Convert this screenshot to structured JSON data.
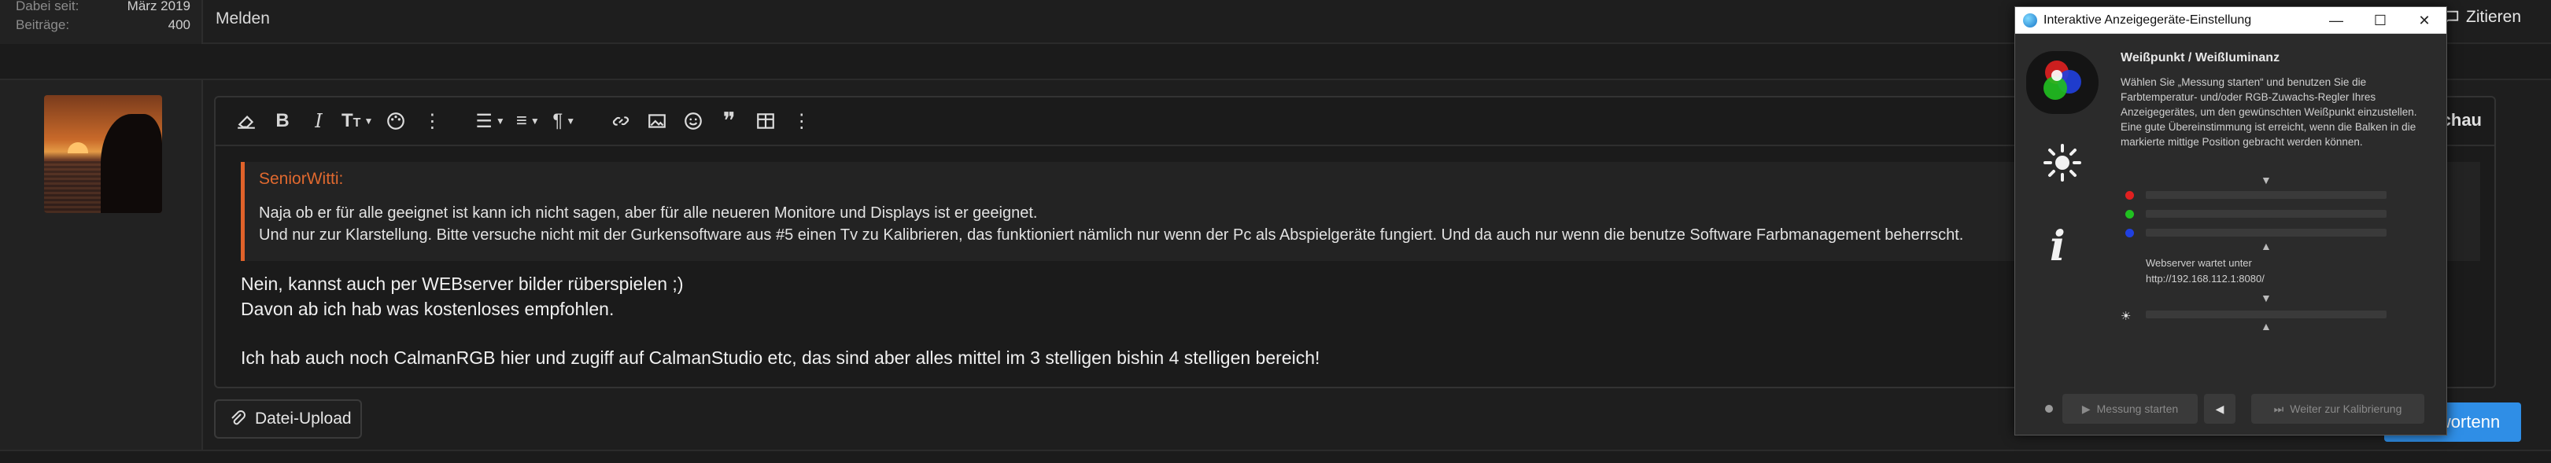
{
  "post_meta": {
    "joined_label": "Dabei seit:",
    "joined_value": "März 2019",
    "posts_label": "Beiträge:",
    "posts_value": "400"
  },
  "post_actions": {
    "report": "Melden",
    "quote": "Zitieren"
  },
  "editor": {
    "preview": "rschau",
    "quote_block": {
      "author": "SeniorWitti:",
      "lines": [
        "Naja ob er für alle geeignet ist kann ich nicht sagen, aber für alle neueren Monitore und Displays ist er geeignet.",
        "Und nur zur Klarstellung. Bitte versuche nicht mit der Gurkensoftware aus #5 einen Tv zu Kalibrieren, das funktioniert nämlich nur wenn der Pc als Abspielgeräte fungiert. Und da auch nur wenn die benutze Software Farbmanagement beherrscht."
      ]
    },
    "body": {
      "line1": "Nein, kannst auch per WEBserver bilder rüberspielen ;)",
      "line2": "Davon ab ich hab was kostenloses empfohlen.",
      "line3": "Ich hab auch noch CalmanRGB hier und zugiff auf CalmanStudio etc, das sind aber alles mittel im 3 stelligen bishin 4 stelligen bereich!"
    },
    "upload_label": "Datei-Upload",
    "submit_label": "twortenn"
  },
  "dialog": {
    "window_title": "Interaktive Anzeigegeräte-Einstellung",
    "heading": "Weißpunkt / Weißluminanz",
    "description": "Wählen Sie „Messung starten“ und benutzen Sie die Farbtemperatur- und/oder RGB-Zuwachs-Regler Ihres Anzeigegerätes, um den gewünschten Weißpunkt einzustellen. Eine gute Übereinstimmung ist erreicht, wenn die Balken in die markierte mittige Position gebracht werden können.",
    "status_line1": "Webserver wartet unter",
    "status_line2": "http://192.168.112.1:8080/",
    "start_button": "Messung starten",
    "next_button": "Weiter zur Kalibrierung",
    "colors": {
      "red": "#e02020",
      "green": "#20c020",
      "blue": "#2040e0"
    }
  }
}
